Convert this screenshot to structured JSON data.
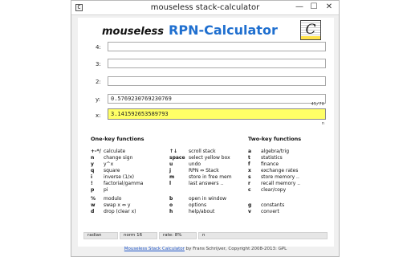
{
  "window": {
    "title": "mouseless stack-calculator",
    "icon_glyph": "C",
    "controls": {
      "minimize": "—",
      "maximize": "☐",
      "close": "✕"
    }
  },
  "header": {
    "brand_a": "mouseless",
    "brand_b": "RPN-Calculator",
    "logo_letter": "C"
  },
  "registers": {
    "r4": {
      "label": "4:",
      "value": ""
    },
    "r3": {
      "label": "3:",
      "value": ""
    },
    "r2": {
      "label": "2:",
      "value": ""
    },
    "y": {
      "label": "y:",
      "value": "0.5769230769230769"
    },
    "x": {
      "label": "x:",
      "value": "3.141592653589793"
    }
  },
  "counter": "45/70",
  "small_mark": "n",
  "help": {
    "one_title": "One-key functions",
    "two_title": "Two-key functions",
    "one_a": [
      {
        "key": "+-*/",
        "desc": "calculate"
      },
      {
        "key": "n",
        "desc": "change sign"
      },
      {
        "key": "y",
        "desc": "y^x"
      },
      {
        "key": "q",
        "desc": "square"
      },
      {
        "key": "i",
        "desc": "inverse (1/x)"
      },
      {
        "key": "!",
        "desc": "factorial/gamma"
      },
      {
        "key": "p",
        "desc": "pi"
      },
      {
        "key": "%",
        "desc": "modulo"
      },
      {
        "key": "w",
        "desc": "swap x ⇔ y"
      },
      {
        "key": "d",
        "desc": "drop (clear x)"
      }
    ],
    "one_b": [
      {
        "key": "↑↓",
        "desc": "scroll stack"
      },
      {
        "key": "space",
        "desc": "select yellow box"
      },
      {
        "key": "u",
        "desc": "undo"
      },
      {
        "key": "j",
        "desc": "RPN ⇔ Stack"
      },
      {
        "key": "m",
        "desc": "store in free mem"
      },
      {
        "key": "l",
        "desc": "last answers .."
      },
      {
        "key": "b",
        "desc": "open in window"
      },
      {
        "key": "o",
        "desc": "options"
      },
      {
        "key": "h",
        "desc": "help/about"
      }
    ],
    "two": [
      {
        "key": "a",
        "desc": "algebra/trig"
      },
      {
        "key": "t",
        "desc": "statistics"
      },
      {
        "key": "f",
        "desc": "finance"
      },
      {
        "key": "x",
        "desc": "exchange rates"
      },
      {
        "key": "s",
        "desc": "store memory .."
      },
      {
        "key": "r",
        "desc": "recall memory .."
      },
      {
        "key": "c",
        "desc": "clear/copy"
      },
      {
        "key": "g",
        "desc": "constants"
      },
      {
        "key": "v",
        "desc": "convert"
      }
    ]
  },
  "status": {
    "angle": "radian",
    "format": "norm 16",
    "rate": "rate: 8%",
    "mode": "n"
  },
  "footer": {
    "link": "Mouseless Stack Calculator",
    "text": " by Frans Schrijver, Copyright 2008-2013: GPL"
  }
}
